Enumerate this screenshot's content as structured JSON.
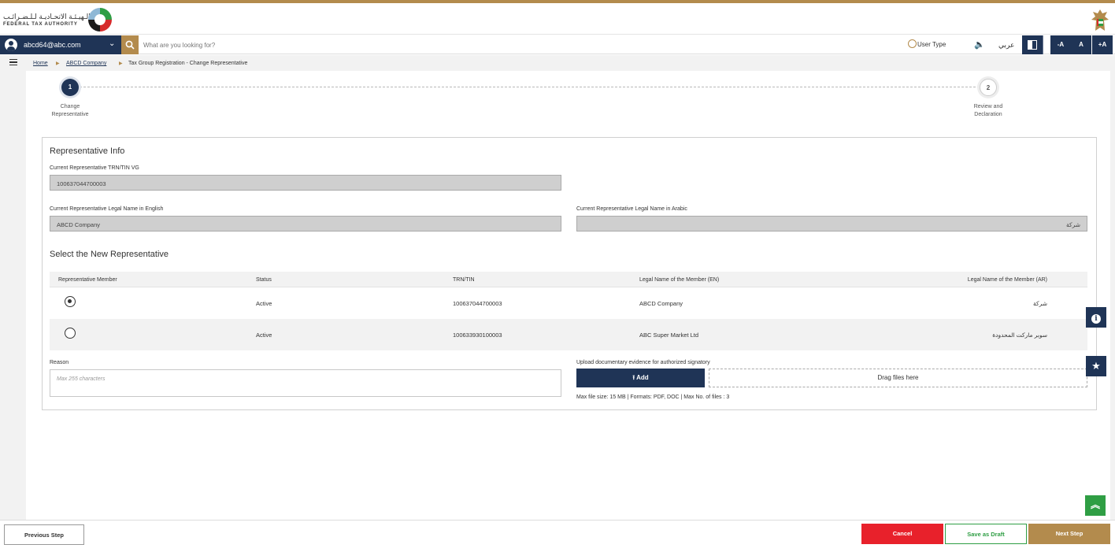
{
  "logo": {
    "arabic": "الـهيـئـة الاتحـاديـة لـلـضـرائـب",
    "english": "FEDERAL TAX AUTHORITY"
  },
  "nav": {
    "user_email": "abcd64@abc.com",
    "search_placeholder": "What are you looking for?",
    "user_type": "User Type",
    "language": "عربي",
    "font_decrease": "-A",
    "font_reset": "A",
    "font_increase": "+A"
  },
  "breadcrumb": {
    "home": "Home",
    "company": "ABCD Company",
    "current": "Tax Group Registration - Change Representative"
  },
  "steps": [
    {
      "number": "1",
      "label_line1": "Change",
      "label_line2": "Representative",
      "state": "active"
    },
    {
      "number": "2",
      "label_line1": "Review and",
      "label_line2": "Declaration",
      "state": "pending"
    }
  ],
  "rep_info": {
    "title": "Representative Info",
    "trn_label": "Current Representative TRN/TIN VG",
    "trn_value": "100637044700003",
    "name_en_label": "Current Representative Legal Name in English",
    "name_en_value": "ABCD Company",
    "name_ar_label": "Current Representative Legal Name in Arabic",
    "name_ar_value": "شركة"
  },
  "new_rep": {
    "title": "Select the New Representative",
    "columns": [
      "Representative Member",
      "Status",
      "TRN/TIN",
      "Legal Name of the Member (EN)",
      "Legal Name of the Member (AR)"
    ],
    "rows": [
      {
        "selected": true,
        "status": "Active",
        "trn": "100637044700003",
        "name_en": "ABCD Company",
        "name_ar": "شركة"
      },
      {
        "selected": false,
        "status": "Active",
        "trn": "100633930100003",
        "name_en": "ABC Super Market Ltd",
        "name_ar": "سوبر ماركت المحدودة"
      }
    ]
  },
  "reason": {
    "label": "Reason",
    "placeholder": "Max 255 characters"
  },
  "upload": {
    "label": "Upload documentary evidence for authorized signatory",
    "add_label": "Add",
    "drop_label": "Drag files here",
    "hint": "Max file size: 15 MB | Formats: PDF, DOC | Max No. of files : 3"
  },
  "footer": {
    "previous": "Previous Step",
    "cancel": "Cancel",
    "save_draft": "Save as Draft",
    "next": "Next Step"
  },
  "colors": {
    "navy": "#1f3456",
    "gold": "#b38b4d",
    "red": "#e8212b",
    "green": "#2f9e44"
  },
  "icons": [
    "user-icon",
    "chevron-down-icon",
    "search-icon",
    "user-type-icon",
    "speaker-icon",
    "contrast-icon",
    "menu-icon",
    "upload-icon",
    "info-icon",
    "star-icon",
    "scroll-top-icon"
  ]
}
